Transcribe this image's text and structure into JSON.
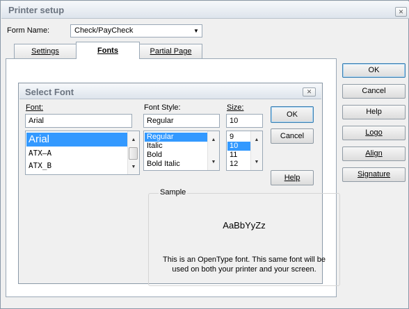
{
  "window": {
    "title": "Printer setup",
    "close_glyph": "✕"
  },
  "form": {
    "label": "Form Name:",
    "value": "Check/PayCheck",
    "arrow": "▼"
  },
  "tabs": [
    {
      "label": "Settings",
      "active": false
    },
    {
      "label": "Fonts",
      "active": true
    },
    {
      "label": "Partial Page",
      "active": false
    }
  ],
  "right_buttons": {
    "ok": "OK",
    "cancel": "Cancel",
    "help": "Help",
    "logo": "Logo",
    "align": "Align",
    "signature": "Signature"
  },
  "dialog": {
    "title": "Select Font",
    "close_glyph": "✕",
    "font": {
      "label": "Font:",
      "value": "Arial",
      "items": [
        "Arial",
        "ATX—A",
        "ATX_B"
      ],
      "selected": "Arial"
    },
    "style": {
      "label": "Font Style:",
      "value": "Regular",
      "items": [
        "Regular",
        "Italic",
        "Bold",
        "Bold Italic"
      ],
      "selected": "Regular"
    },
    "size": {
      "label": "Size:",
      "value": "10",
      "items": [
        "9",
        "10",
        "11",
        "12"
      ],
      "selected": "10"
    },
    "buttons": {
      "ok": "OK",
      "cancel": "Cancel",
      "help": "Help"
    },
    "sample": {
      "label": "Sample",
      "text": "AaBbYyZz"
    },
    "note": {
      "line1": "This is an OpenType font. This same font will be",
      "line2": "used on both your printer and your screen."
    }
  },
  "scroll": {
    "up": "▲",
    "down": "▼"
  },
  "colors": {
    "selection": "#3399ff",
    "title_text": "#6b7480"
  }
}
